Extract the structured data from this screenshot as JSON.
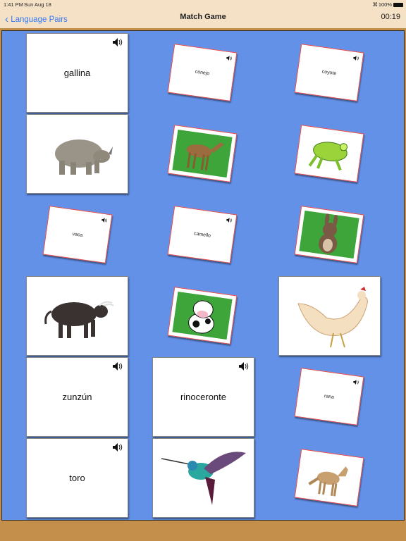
{
  "status_bar": {
    "time": "1:41 PM",
    "date": "Sun Aug 18",
    "battery": "100%"
  },
  "nav": {
    "back_label": "Language Pairs",
    "title": "Match Game",
    "timer": "00:19"
  },
  "colors": {
    "board": "#6391E8",
    "wood": "#C48E4B",
    "header": "#F5E1C5",
    "selected_border": "#E0474C",
    "link": "#3478F6"
  },
  "cards": [
    {
      "type": "word",
      "label": "gallina"
    },
    {
      "type": "word",
      "label": "conejo"
    },
    {
      "type": "word",
      "label": "coyote"
    },
    {
      "type": "image",
      "animal": "rhinoceros"
    },
    {
      "type": "image",
      "animal": "camel"
    },
    {
      "type": "image",
      "animal": "frog"
    },
    {
      "type": "word",
      "label": "vaca"
    },
    {
      "type": "word",
      "label": "camello"
    },
    {
      "type": "image",
      "animal": "rabbit"
    },
    {
      "type": "image",
      "animal": "bull"
    },
    {
      "type": "image",
      "animal": "cow"
    },
    {
      "type": "image",
      "animal": "hen"
    },
    {
      "type": "word",
      "label": "zunzún"
    },
    {
      "type": "word",
      "label": "rinoceronte"
    },
    {
      "type": "word",
      "label": "rana"
    },
    {
      "type": "word",
      "label": "toro"
    },
    {
      "type": "image",
      "animal": "hummingbird"
    },
    {
      "type": "image",
      "animal": "coyote"
    }
  ]
}
